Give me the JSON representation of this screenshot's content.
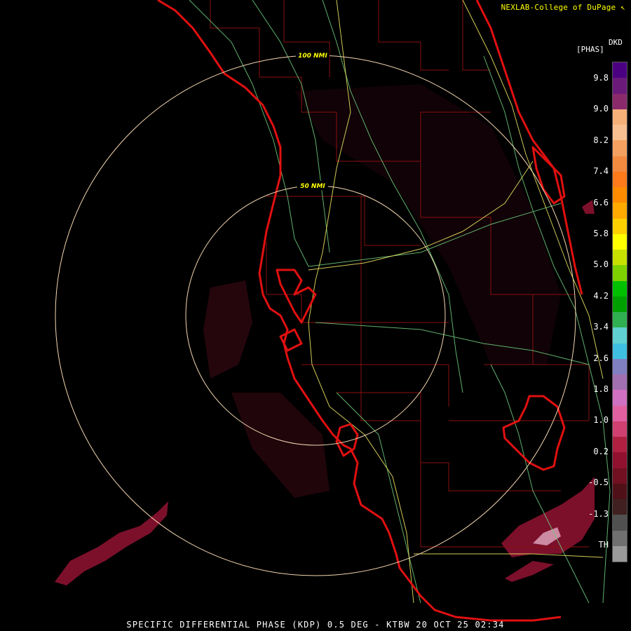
{
  "header": {
    "credit": "NEXLAB-College of DuPage",
    "credit_mark": "↖",
    "product_code": "DKD",
    "product_unit": "[PHAS]"
  },
  "footer": {
    "caption": "SPECIFIC DIFFERENTIAL PHASE (KDP) 0.5 DEG - KTBW 20 OCT 25 02:34"
  },
  "range_rings": [
    {
      "label": "100 NMI"
    },
    {
      "label": "50 NMI"
    }
  ],
  "colorbar": {
    "labels": [
      "9.8",
      "9.0",
      "8.2",
      "7.4",
      "6.6",
      "5.8",
      "5.0",
      "4.2",
      "3.4",
      "2.6",
      "1.8",
      "1.0",
      "0.2",
      "-0.5",
      "-1.3",
      "TH"
    ],
    "colors": [
      "#4b0082",
      "#6a1b7a",
      "#8b2a6b",
      "#f5b07a",
      "#f8c090",
      "#f5a060",
      "#f28a40",
      "#ff7a1a",
      "#ff8c00",
      "#ffaa00",
      "#ffd000",
      "#ffff00",
      "#c8e000",
      "#7fd000",
      "#00c000",
      "#00a000",
      "#30b050",
      "#60d0d0",
      "#40c0e0",
      "#8080c0",
      "#a070b0",
      "#d070c0",
      "#e060a0",
      "#d04070",
      "#b02040",
      "#901030",
      "#701020",
      "#501018",
      "#402020",
      "#505050",
      "#707070",
      "#9a9a9a"
    ]
  }
}
